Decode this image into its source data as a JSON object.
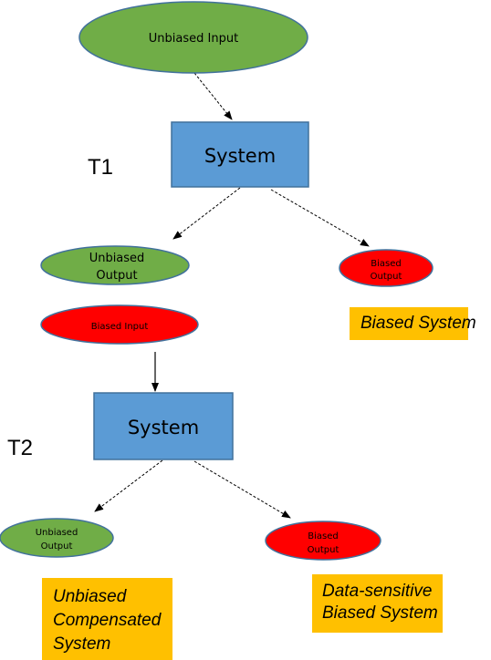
{
  "colors": {
    "green": "#70AD47",
    "red": "#FF0000",
    "blue": "#5B9BD5",
    "outline": "#41719C",
    "label_bg": "#FFC000"
  },
  "stage1": {
    "time_label": "T1",
    "input": "Unbiased Input",
    "system": "System",
    "out_unbiased": [
      "Unbiased",
      "Output"
    ],
    "out_biased": [
      "Biased",
      "Output"
    ],
    "caption": "Biased System"
  },
  "stage2": {
    "time_label": "T2",
    "input": "Biased Input",
    "system": "System",
    "out_unbiased": [
      "Unbiased",
      "Output"
    ],
    "out_biased": [
      "Biased",
      "Output"
    ],
    "caption_left": [
      "Unbiased",
      "Compensated",
      "System"
    ],
    "caption_right": [
      "Data-sensitive",
      "Biased System"
    ]
  }
}
